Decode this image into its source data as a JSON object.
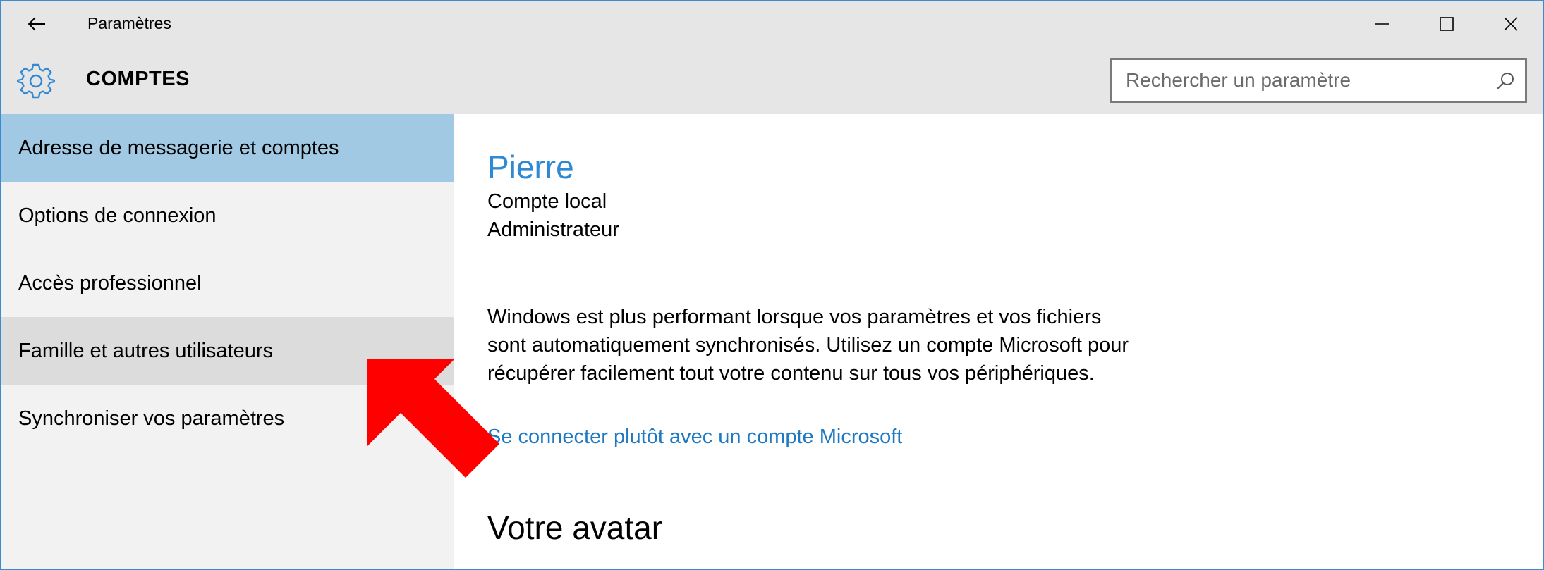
{
  "window": {
    "title": "Paramètres",
    "controls": {
      "minimize": "minimize",
      "maximize": "maximize",
      "close": "close"
    }
  },
  "header": {
    "icon": "gear-icon",
    "section_title": "COMPTES",
    "search": {
      "placeholder": "Rechercher un paramètre",
      "value": ""
    }
  },
  "sidebar": {
    "items": [
      {
        "label": "Adresse de messagerie et comptes",
        "state": "selected"
      },
      {
        "label": "Options de connexion",
        "state": "normal"
      },
      {
        "label": "Accès professionnel",
        "state": "normal"
      },
      {
        "label": "Famille et autres utilisateurs",
        "state": "hovered"
      },
      {
        "label": "Synchroniser vos paramètres",
        "state": "normal"
      }
    ]
  },
  "main": {
    "user_name": "Pierre",
    "account_type": "Compte local",
    "account_role": "Administrateur",
    "sync_description": "Windows est plus performant lorsque vos paramètres et vos fichiers sont automatiquement synchronisés. Utilisez un compte Microsoft pour récupérer facilement tout votre contenu sur tous vos périphériques.",
    "microsoft_link": "Se connecter plutôt avec un compte Microsoft",
    "avatar_heading": "Votre avatar"
  },
  "colors": {
    "accent": "#2f8ad3",
    "link": "#1e79c2",
    "selected_bg": "#a1c9e4",
    "hover_bg": "#dcdcdc",
    "annotation_arrow": "#ff0000"
  }
}
